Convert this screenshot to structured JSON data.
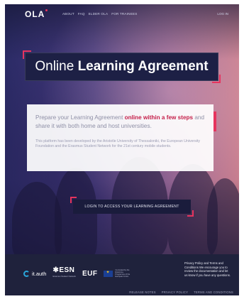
{
  "nav": {
    "logo": "OLA",
    "links": [
      "ABOUT",
      "FAQ",
      "ELDER OLA",
      "FOR TRAINEES"
    ],
    "login": "LOG IN"
  },
  "hero": {
    "title_light": "Online",
    "title_bold": "Learning Agreement"
  },
  "intro": {
    "lead_before": "Prepare your Learning Agreement ",
    "lead_highlight": "online within a few steps",
    "lead_after": " and share it with both home and host universities.",
    "description": "This platform has been developed by the Aristotle University of Thessaloniki, the European University Foundation and the Erasmus Student Network for the 21st century mobile students."
  },
  "cta": {
    "label": "LOGIN TO ACCESS YOUR LEARNING AGREEMENT"
  },
  "footer": {
    "partners": {
      "auth": "it.auth",
      "esn": "ESN",
      "esn_sub": "Erasmus Student Network",
      "euf": "EUF",
      "eu_text": "Co-funded by the Erasmus+ Programme of the European Union"
    },
    "privacy_text": "Privacy Policy and Terms and Conditions We encourage you to review the documentation and let us know if you have any questions.",
    "links": [
      "RELEASE NOTES",
      "PRIVACY POLICY",
      "TERMS AND CONDITIONS"
    ]
  },
  "colors": {
    "accent": "#e6345e",
    "navy": "#1d2045",
    "footer_bg": "#1f223c"
  }
}
